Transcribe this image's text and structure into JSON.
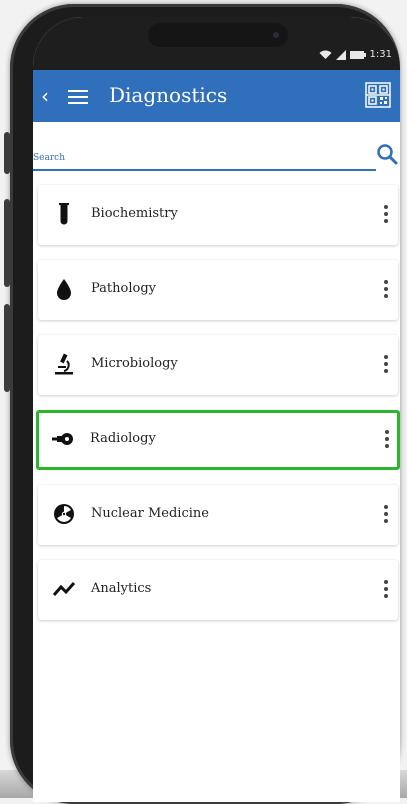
{
  "status_bar": {
    "time": "1:31"
  },
  "app_bar": {
    "title": "Diagnostics"
  },
  "search": {
    "placeholder": "Search"
  },
  "items": [
    {
      "label": "Biochemistry",
      "icon": "test-tube-icon"
    },
    {
      "label": "Pathology",
      "icon": "drop-icon"
    },
    {
      "label": "Microbiology",
      "icon": "microscope-icon"
    },
    {
      "label": "Radiology",
      "icon": "xray-icon",
      "selected": true
    },
    {
      "label": "Nuclear Medicine",
      "icon": "radiation-icon"
    },
    {
      "label": "Analytics",
      "icon": "trend-line-icon"
    }
  ],
  "colors": {
    "primary": "#2f6fbb",
    "selected_border": "#2db52d"
  }
}
